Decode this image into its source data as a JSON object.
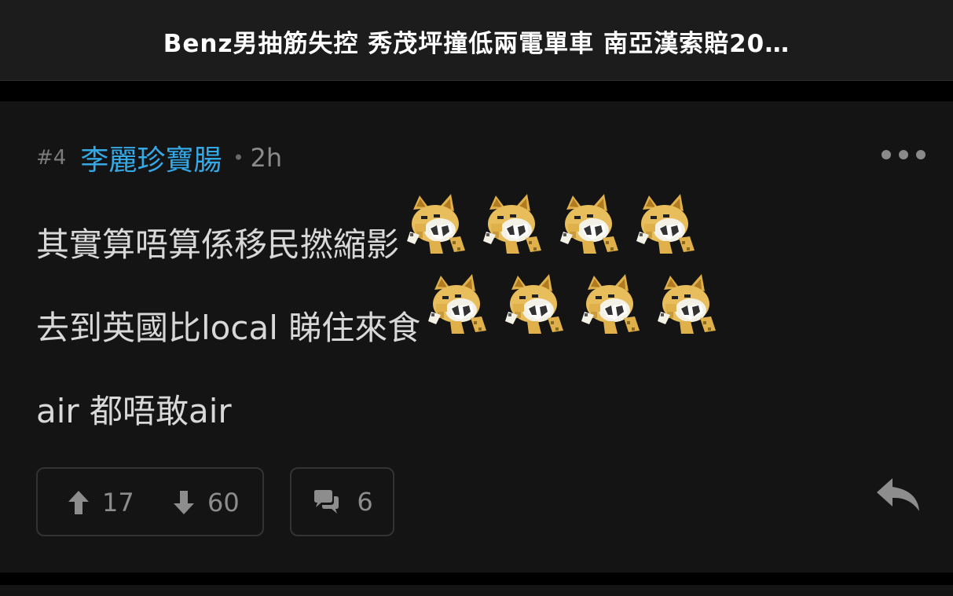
{
  "header": {
    "title": "Benz男抽筋失控  秀茂坪撞低兩電單車  南亞漢索賠20…"
  },
  "post": {
    "floor": "#4",
    "author": "李麗珍寶腸",
    "separator": "•",
    "time": "2h",
    "lines": [
      "其實算唔算係移民撚縮影",
      "去到英國比local 睇住來食",
      "air 都唔敢air"
    ],
    "emoji_icon": "laughing-dog-emoji-icon",
    "emoji_count_line1": 4,
    "emoji_count_line2": 4
  },
  "actions": {
    "upvotes": "17",
    "downvotes": "60",
    "comments": "6"
  },
  "colors": {
    "author": "#35a8e6",
    "background": "#141414",
    "text": "#d8d8d8",
    "muted": "#8d8d8d"
  }
}
